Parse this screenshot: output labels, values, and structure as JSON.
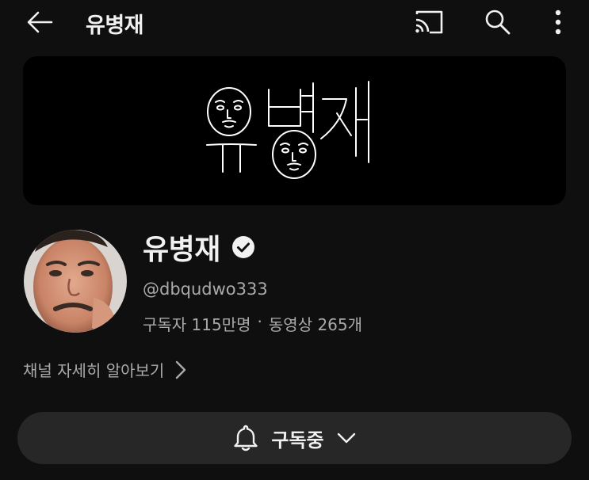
{
  "header": {
    "title": "유병재",
    "icons": [
      "arrow-left-icon",
      "cast-icon",
      "search-icon",
      "more-vert-icon"
    ]
  },
  "channel": {
    "name": "유병재",
    "handle": "@dbqudwo333",
    "subscribers": "구독자 115만명",
    "separator": "·",
    "videos": "동영상 265개",
    "more_info": "채널 자세히 알아보기"
  },
  "subscribe": {
    "label": "구독중"
  },
  "colors": {
    "background": "#0f0f0f",
    "secondary_text": "#aaaaaa",
    "button_bg": "#272727"
  }
}
